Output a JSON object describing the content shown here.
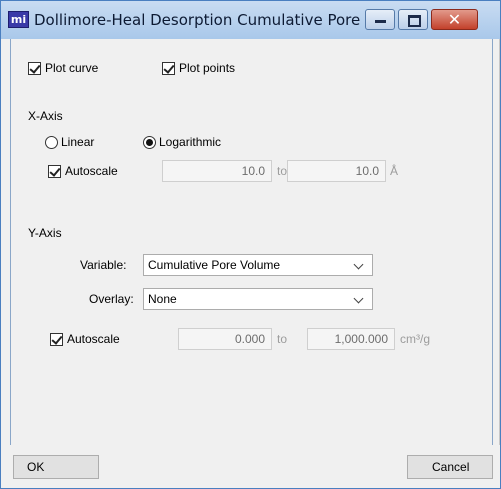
{
  "window": {
    "title": "Dollimore-Heal Desorption Cumulative Pore ...",
    "app_icon_text": "mi",
    "close_glyph": "✕"
  },
  "plot": {
    "curve_label": "Plot curve",
    "curve_checked": true,
    "points_label": "Plot points",
    "points_checked": true
  },
  "x_axis": {
    "section_label": "X-Axis",
    "scale_options": [
      "Linear",
      "Logarithmic"
    ],
    "selected_scale": "Logarithmic",
    "autoscale_label": "Autoscale",
    "autoscale_checked": true,
    "from_value": "10.0",
    "to_label": "to",
    "to_value": "10.0",
    "unit": "Å"
  },
  "y_axis": {
    "section_label": "Y-Axis",
    "variable_label": "Variable:",
    "variable_value": "Cumulative Pore Volume",
    "overlay_label": "Overlay:",
    "overlay_value": "None",
    "autoscale_label": "Autoscale",
    "autoscale_checked": true,
    "from_value": "0.000",
    "to_label": "to",
    "to_value": "1,000.000",
    "unit": "cm³/g"
  },
  "buttons": {
    "ok_label": "OK",
    "cancel_label": "Cancel"
  }
}
